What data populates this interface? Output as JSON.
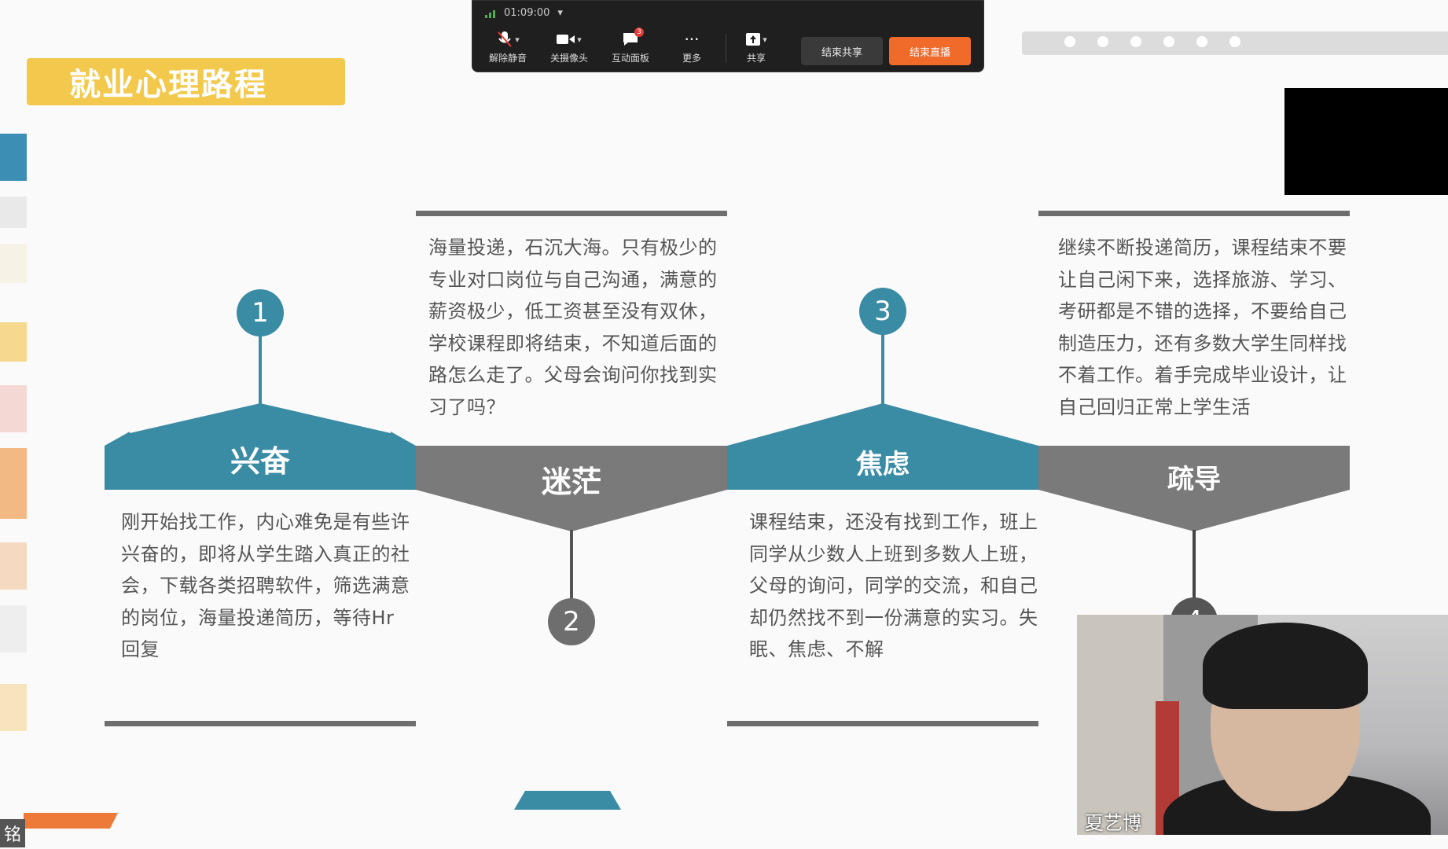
{
  "slide": {
    "title": "就业心理路程",
    "stages": [
      {
        "number": "1",
        "label": "兴奋",
        "text": "刚开始找工作，内心难免是有些许兴奋的，即将从学生踏入真正的社会，下载各类招聘软件，筛选满意的岗位，海量投递简历，等待Hr回复"
      },
      {
        "number": "2",
        "label": "迷茫",
        "text": "海量投递，石沉大海。只有极少的专业对口岗位与自己沟通，满意的薪资极少，低工资甚至没有双休，学校课程即将结束，不知道后面的路怎么走了。父母会询问你找到实习了吗？"
      },
      {
        "number": "3",
        "label": "焦虑",
        "text": "课程结束，还没有找到工作，班上同学从少数人上班到多数人上班，父母的询问，同学的交流，和自己却仍然找不到一份满意的实习。失眠、焦虑、不解"
      },
      {
        "number": "4",
        "label": "疏导",
        "text": "继续不断投递简历，课程结束不要让自己闲下来，选择旅游、学习、考研都是不错的选择，不要给自己制造压力，还有多数大学生同样找不着工作。着手完成毕业设计，让自己回归正常上学生活"
      }
    ],
    "colors": {
      "teal": "#3a8ba4",
      "gray": "#7a7a7a",
      "title_bg": "#f2c94c"
    }
  },
  "toolbar": {
    "timer": "01:09:00",
    "buttons": [
      {
        "label": "解除静音",
        "icon": "microphone-muted-icon"
      },
      {
        "label": "关摄像头",
        "icon": "camera-icon"
      },
      {
        "label": "互动面板",
        "icon": "chat-icon",
        "badge": "3"
      },
      {
        "label": "更多",
        "icon": "more-icon"
      },
      {
        "label": "共享",
        "icon": "share-icon"
      }
    ],
    "end_share": "结束共享",
    "end_live": "结束直播"
  },
  "video": {
    "name": "夏艺博"
  },
  "corner_label": "铭"
}
